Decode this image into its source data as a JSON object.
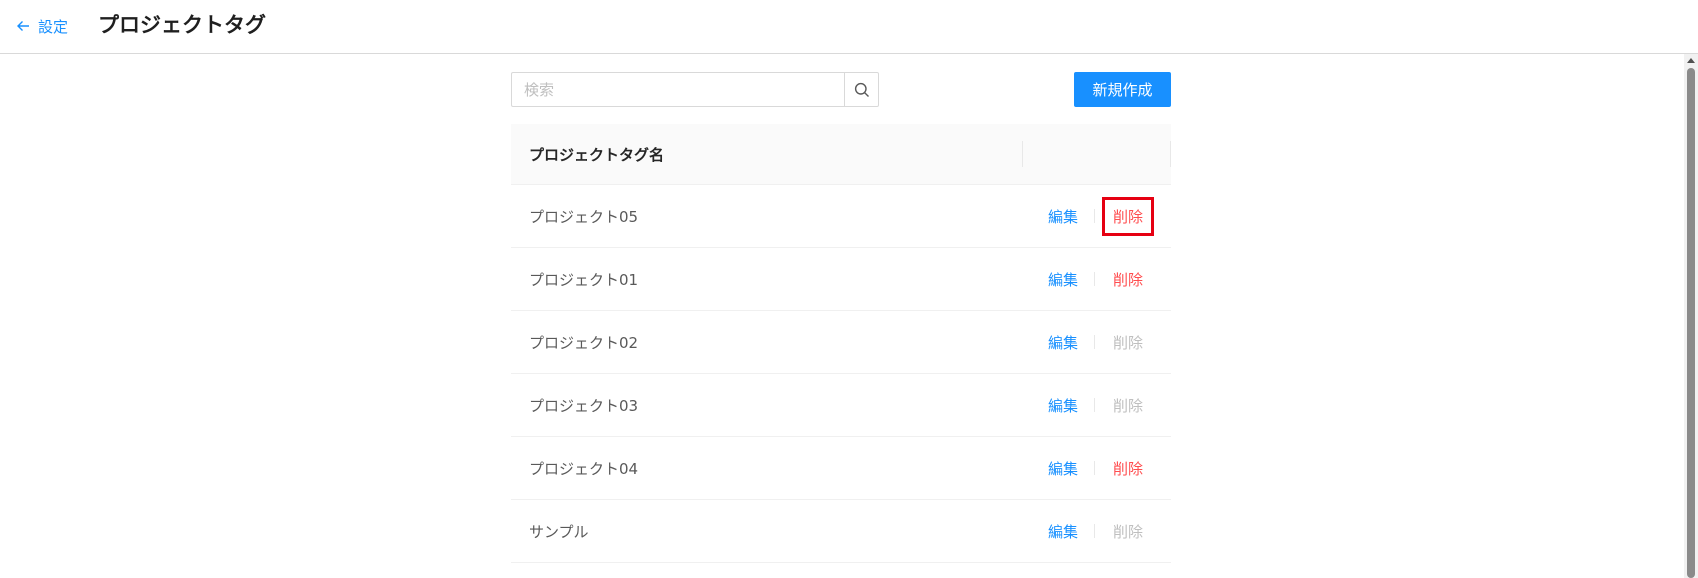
{
  "header": {
    "back_label": "設定",
    "title": "プロジェクトタグ"
  },
  "toolbar": {
    "search_placeholder": "検索",
    "search_value": "",
    "create_label": "新規作成"
  },
  "table": {
    "column_name": "プロジェクトタグ名",
    "edit_label": "編集",
    "delete_label": "削除",
    "rows": [
      {
        "name": "プロジェクト05",
        "delete_enabled": true,
        "delete_highlighted": true
      },
      {
        "name": "プロジェクト01",
        "delete_enabled": true,
        "delete_highlighted": false
      },
      {
        "name": "プロジェクト02",
        "delete_enabled": false,
        "delete_highlighted": false
      },
      {
        "name": "プロジェクト03",
        "delete_enabled": false,
        "delete_highlighted": false
      },
      {
        "name": "プロジェクト04",
        "delete_enabled": true,
        "delete_highlighted": false
      },
      {
        "name": "サンプル",
        "delete_enabled": false,
        "delete_highlighted": false
      }
    ]
  },
  "colors": {
    "primary": "#1890ff",
    "danger": "#ff4d4f",
    "disabled": "#bfbfbf",
    "highlight": "#e60012"
  }
}
